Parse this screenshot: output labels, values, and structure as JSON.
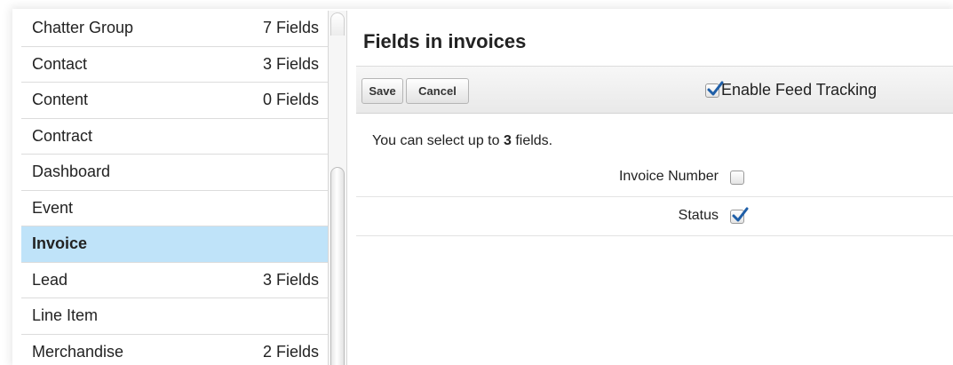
{
  "objects": [
    {
      "name": "Chatter Group",
      "count": "7 Fields"
    },
    {
      "name": "Contact",
      "count": "3 Fields"
    },
    {
      "name": "Content",
      "count": "0 Fields"
    },
    {
      "name": "Contract",
      "count": ""
    },
    {
      "name": "Dashboard",
      "count": ""
    },
    {
      "name": "Event",
      "count": ""
    },
    {
      "name": "Invoice",
      "count": "",
      "selected": true
    },
    {
      "name": "Lead",
      "count": "3 Fields"
    },
    {
      "name": "Line Item",
      "count": ""
    },
    {
      "name": "Merchandise",
      "count": "2 Fields"
    }
  ],
  "panel": {
    "title": "Fields in invoices",
    "save_label": "Save",
    "cancel_label": "Cancel",
    "feed_tracking_label": "Enable Feed Tracking",
    "feed_tracking_checked": true,
    "hint_prefix": "You can select up to ",
    "hint_limit": "3",
    "hint_suffix": " fields.",
    "fields": [
      {
        "label": "Invoice Number",
        "checked": false
      },
      {
        "label": "Status",
        "checked": true
      }
    ]
  },
  "colors": {
    "selected_row": "#bfe3f9",
    "checkmark": "#1f5fa8"
  },
  "icons": {
    "checkbox_checked": "checkbox-checked-icon",
    "checkbox_unchecked": "checkbox-unchecked-icon"
  }
}
